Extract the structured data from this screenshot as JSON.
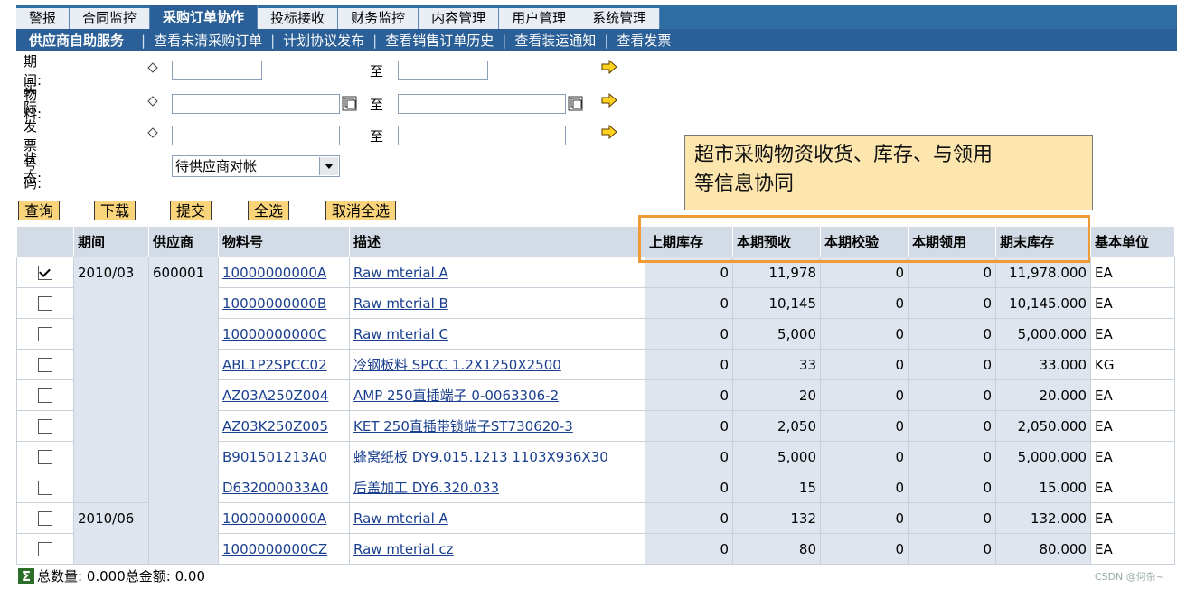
{
  "topnav": {
    "tabs": [
      "警报",
      "合同监控",
      "采购订单协作",
      "投标接收",
      "财务监控",
      "内容管理",
      "用户管理",
      "系统管理"
    ],
    "active": "采购订单协作"
  },
  "subnav": {
    "items": [
      "供应商自助服务",
      "查看未清采购订单",
      "计划协议发布",
      "查看销售订单历史",
      "查看装运通知",
      "查看发票"
    ],
    "separator": "|"
  },
  "filters": {
    "period_label": "期间:",
    "material_label": "物料:",
    "invoice_label": "实际发票号码:",
    "status_label": "状态:",
    "to_label": "至",
    "status_value": "待供应商对帐"
  },
  "buttons": {
    "query": "查询",
    "download": "下载",
    "submit": "提交",
    "select_all": "全选",
    "deselect_all": "取消全选"
  },
  "annotation": {
    "line1": "超市采购物资收货、库存、与领用",
    "line2": "等信息协同"
  },
  "table": {
    "headers": [
      "期间",
      "供应商",
      "物料号",
      "描述",
      "上期库存",
      "本期预收",
      "本期校验",
      "本期领用",
      "期末库存",
      "基本单位"
    ],
    "rows": [
      {
        "checked": true,
        "period": "2010/03",
        "vendor": "600001",
        "material": "10000000000A",
        "desc": "Raw mterial A",
        "prev": "0",
        "recv": "11,978",
        "check": "0",
        "used": "0",
        "end": "11,978.000",
        "unit": "EA"
      },
      {
        "checked": false,
        "period": "",
        "vendor": "",
        "material": "10000000000B",
        "desc": "Raw mterial B",
        "prev": "0",
        "recv": "10,145",
        "check": "0",
        "used": "0",
        "end": "10,145.000",
        "unit": "EA"
      },
      {
        "checked": false,
        "period": "",
        "vendor": "",
        "material": "10000000000C",
        "desc": "Raw mterial C",
        "prev": "0",
        "recv": "5,000",
        "check": "0",
        "used": "0",
        "end": "5,000.000",
        "unit": "EA"
      },
      {
        "checked": false,
        "period": "",
        "vendor": "",
        "material": "ABL1P2SPCC02",
        "desc": "冷钢板料 SPCC 1.2X1250X2500",
        "prev": "0",
        "recv": "33",
        "check": "0",
        "used": "0",
        "end": "33.000",
        "unit": "KG"
      },
      {
        "checked": false,
        "period": "",
        "vendor": "",
        "material": "AZ03A250Z004",
        "desc": "AMP 250直插端子 0-0063306-2",
        "prev": "0",
        "recv": "20",
        "check": "0",
        "used": "0",
        "end": "20.000",
        "unit": "EA"
      },
      {
        "checked": false,
        "period": "",
        "vendor": "",
        "material": "AZ03K250Z005",
        "desc": "KET 250直插带锁端子ST730620-3",
        "prev": "0",
        "recv": "2,050",
        "check": "0",
        "used": "0",
        "end": "2,050.000",
        "unit": "EA"
      },
      {
        "checked": false,
        "period": "",
        "vendor": "",
        "material": "B901501213A0",
        "desc": "蜂窝纸板 DY9.015.1213 1103X936X30",
        "prev": "0",
        "recv": "5,000",
        "check": "0",
        "used": "0",
        "end": "5,000.000",
        "unit": "EA"
      },
      {
        "checked": false,
        "period": "",
        "vendor": "",
        "material": "D632000033A0",
        "desc": "后盖加工 DY6.320.033",
        "prev": "0",
        "recv": "15",
        "check": "0",
        "used": "0",
        "end": "15.000",
        "unit": "EA"
      },
      {
        "checked": false,
        "period": "2010/06",
        "vendor": "",
        "material": "10000000000A",
        "desc": "Raw mterial A",
        "prev": "0",
        "recv": "132",
        "check": "0",
        "used": "0",
        "end": "132.000",
        "unit": "EA"
      },
      {
        "checked": false,
        "period": "",
        "vendor": "",
        "material": "1000000000CZ",
        "desc": "Raw mterial cz",
        "prev": "0",
        "recv": "80",
        "check": "0",
        "used": "0",
        "end": "80.000",
        "unit": "EA"
      }
    ]
  },
  "footer": {
    "summary": "总数量: 0.000总金额: 0.00",
    "watermark": "CSDN @何杂~"
  },
  "colors": {
    "nav_blue": "#2a5f97",
    "button_yellow": "#f9d47a",
    "highlight_orange": "#f09a35",
    "note_bg": "#fde6ae"
  }
}
